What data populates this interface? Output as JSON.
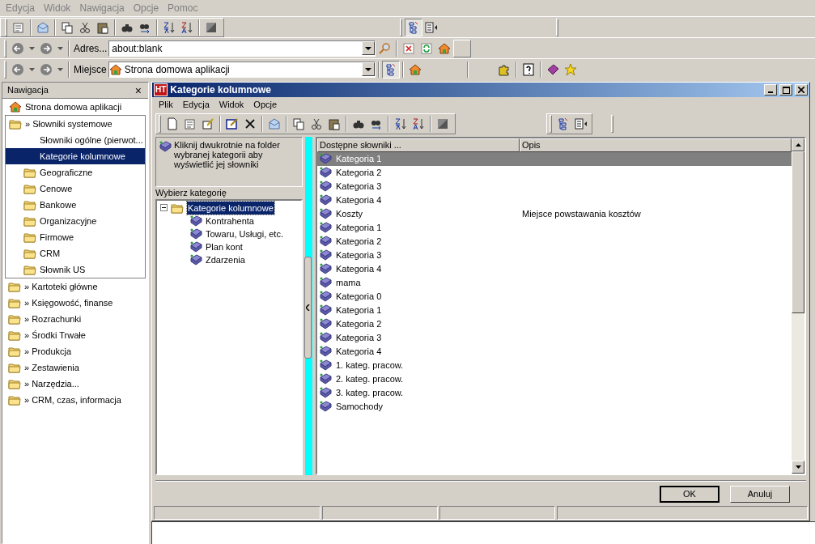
{
  "menu": [
    "Edycja",
    "Widok",
    "Nawigacja",
    "Opcje",
    "Pomoc"
  ],
  "address": {
    "label": "Adres...",
    "value": "about:blank"
  },
  "place": {
    "label": "Miejsce",
    "value": "Strona domowa aplikacji"
  },
  "navigation": {
    "title": "Nawigacja",
    "close": "×",
    "home": "Strona domowa aplikacji",
    "groups": [
      {
        "label": "» Słowniki systemowe",
        "expanded": true,
        "children": [
          {
            "label": "Słowniki ogólne (pierwot...",
            "kind": "plain",
            "selected": false
          },
          {
            "label": "Kategorie kolumnowe",
            "kind": "plain",
            "selected": true
          },
          {
            "label": "Geograficzne",
            "kind": "folder",
            "selected": false
          },
          {
            "label": "Cenowe",
            "kind": "folder",
            "selected": false
          },
          {
            "label": "Bankowe",
            "kind": "folder",
            "selected": false
          },
          {
            "label": "Organizacyjne",
            "kind": "folder",
            "selected": false
          },
          {
            "label": "Firmowe",
            "kind": "folder",
            "selected": false
          },
          {
            "label": "CRM",
            "kind": "folder",
            "selected": false
          },
          {
            "label": "Słownik US",
            "kind": "folder",
            "selected": false
          }
        ]
      },
      {
        "label": "» Kartoteki główne",
        "expanded": false
      },
      {
        "label": "» Księgowość, finanse",
        "expanded": false
      },
      {
        "label": "» Rozrachunki",
        "expanded": false
      },
      {
        "label": "» Środki Trwałe",
        "expanded": false
      },
      {
        "label": "» Produkcja",
        "expanded": false
      },
      {
        "label": "» Zestawienia",
        "expanded": false
      },
      {
        "label": "» Narzędzia...",
        "expanded": false
      },
      {
        "label": "» CRM, czas, informacja",
        "expanded": false
      }
    ]
  },
  "window": {
    "logo": "HT",
    "title": "Kategorie kolumnowe",
    "menu": [
      "Plik",
      "Edycja",
      "Widok",
      "Opcje"
    ],
    "hint": "Kliknij dwukrotnie na folder wybranej kategorii aby wyświetlić jej słowniki",
    "tree_label": "Wybierz kategorię",
    "tree": {
      "label": "Kategorie kolumnowe",
      "expanded": true,
      "selected": true,
      "children": [
        {
          "label": "Kontrahenta"
        },
        {
          "label": "Towaru, Usługi, etc."
        },
        {
          "label": "Plan kont"
        },
        {
          "label": "Zdarzenia"
        }
      ]
    },
    "table": {
      "columns": [
        "Dostępne słowniki ...",
        "Opis"
      ],
      "rows": [
        {
          "name": "Kategoria 1",
          "selected": true
        },
        {
          "name": "Kategoria 2",
          "selected": false
        },
        {
          "name": "Kategoria 3",
          "selected": false
        },
        {
          "name": "Kategoria 4",
          "selected": false
        },
        {
          "name": "Koszty",
          "description": "Miejsce powstawania kosztów",
          "selected": false
        },
        {
          "name": "Kategoria 1",
          "selected": false
        },
        {
          "name": "Kategoria 2",
          "selected": false
        },
        {
          "name": "Kategoria 3",
          "selected": false
        },
        {
          "name": "Kategoria 4",
          "selected": false
        },
        {
          "name": "mama",
          "selected": false
        },
        {
          "name": "Kategoria 0",
          "selected": false
        },
        {
          "name": "Kategoria 1",
          "selected": false
        },
        {
          "name": "Kategoria 2",
          "selected": false
        },
        {
          "name": "Kategoria 3",
          "selected": false
        },
        {
          "name": "Kategoria 4",
          "selected": false
        },
        {
          "name": "1. kateg. pracow.",
          "selected": false
        },
        {
          "name": "2. kateg. pracow.",
          "selected": false
        },
        {
          "name": "3. kateg. pracow.",
          "selected": false
        },
        {
          "name": "Samochody",
          "selected": false
        }
      ]
    },
    "buttons": [
      {
        "label": "OK",
        "default": true
      },
      {
        "label": "Anuluj",
        "default": false
      }
    ]
  }
}
